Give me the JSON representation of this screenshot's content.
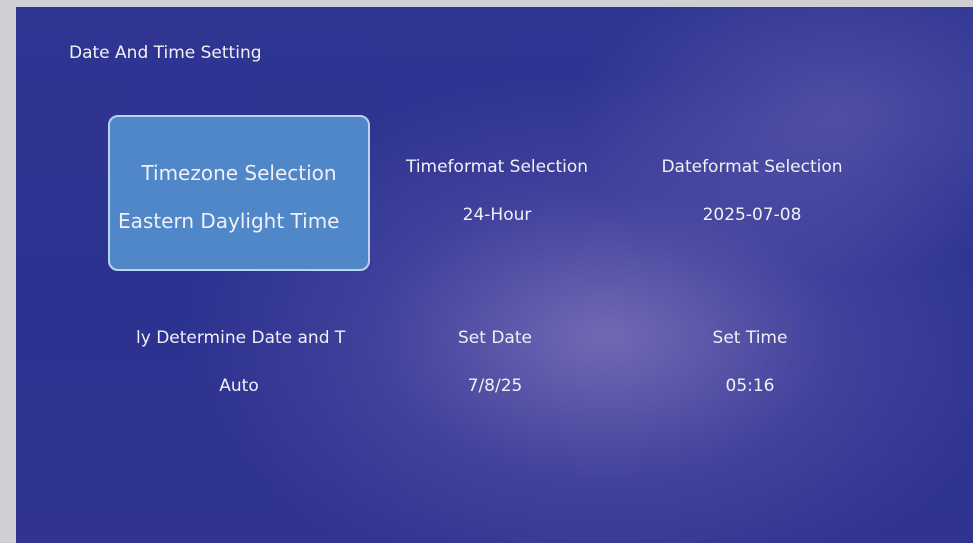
{
  "header": {
    "title": "Date And Time Setting"
  },
  "settings": [
    {
      "label": "Timezone Selection",
      "value": "Eastern Daylight Time",
      "selected": true
    },
    {
      "label": "Timeformat Selection",
      "value": "24-Hour",
      "selected": false
    },
    {
      "label": "Dateformat Selection",
      "value": "2025-07-08",
      "selected": false
    },
    {
      "label": "ly Determine Date and T",
      "value": "Auto",
      "selected": false
    },
    {
      "label": "Set Date",
      "value": "7/8/25",
      "selected": false
    },
    {
      "label": "Set Time",
      "value": "05:16",
      "selected": false
    }
  ],
  "colors": {
    "background": "#2f3591",
    "selected_tile": "#4f87c9",
    "text": "#f0f0f6"
  }
}
